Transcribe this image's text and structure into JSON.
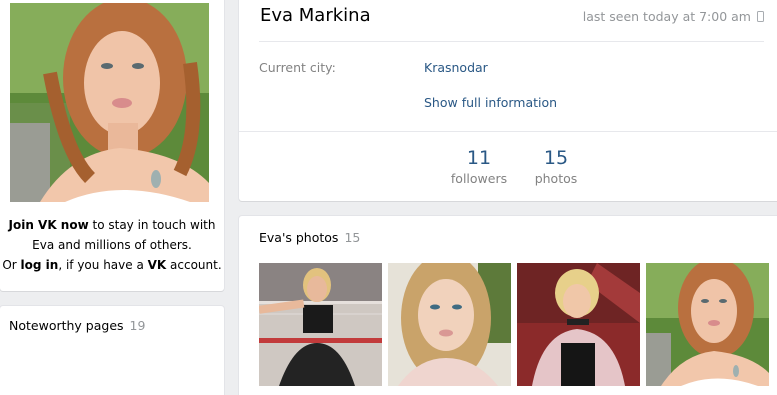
{
  "left": {
    "join_prefix_bold": "Join VK now",
    "join_line1_rest": " to stay in touch with",
    "join_line2": "Eva and millions of others.",
    "join_line3_pre": "Or ",
    "join_login": "log in",
    "join_line3_mid": ", if you have a ",
    "join_vk": "VK",
    "join_line3_end": " account.",
    "noteworthy_title": "Noteworthy pages",
    "noteworthy_count": "19"
  },
  "profile": {
    "name": "Eva Markina",
    "last_seen": "last seen today at 7:00 am",
    "city_label": "Current city:",
    "city_value": "Krasnodar",
    "show_full": "Show full information",
    "counters": [
      {
        "value": "11",
        "label": "followers"
      },
      {
        "value": "15",
        "label": "photos"
      }
    ]
  },
  "photos": {
    "title": "Eva's photos",
    "count": "15"
  },
  "colors": {
    "link": "#2a5885",
    "muted": "#939699",
    "background": "#edeef0"
  }
}
